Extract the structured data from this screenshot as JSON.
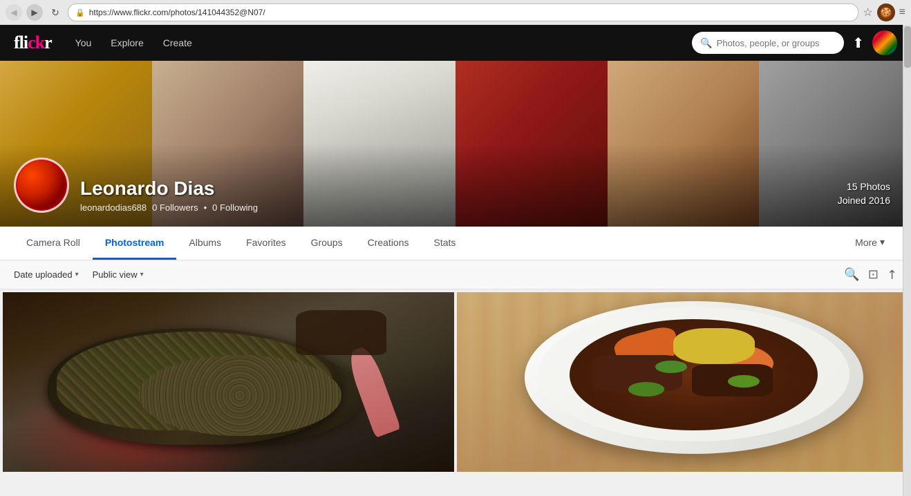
{
  "browser": {
    "url": "https://www.flickr.com/photos/141044352@N07/",
    "back_label": "◀",
    "forward_label": "▶",
    "refresh_label": "↻",
    "star_label": "☆",
    "menu_label": "≡"
  },
  "nav": {
    "logo": "flickr",
    "logo_accent": "fl",
    "you_label": "You",
    "explore_label": "Explore",
    "create_label": "Create",
    "search_placeholder": "Photos, people, or groups",
    "upload_label": "⬆"
  },
  "profile": {
    "name": "Leonardo Dias",
    "username": "leonardodias688",
    "followers": "0 Followers",
    "following": "0 Following",
    "photos_count": "15 Photos",
    "joined": "Joined 2016"
  },
  "tabs": [
    {
      "label": "Camera Roll",
      "active": false
    },
    {
      "label": "Photostream",
      "active": true
    },
    {
      "label": "Albums",
      "active": false
    },
    {
      "label": "Favorites",
      "active": false
    },
    {
      "label": "Groups",
      "active": false
    },
    {
      "label": "Creations",
      "active": false
    },
    {
      "label": "Stats",
      "active": false
    }
  ],
  "more_tab": "More",
  "filters": {
    "date_label": "Date uploaded",
    "view_label": "Public view"
  },
  "filter_actions": {
    "search_icon": "🔍",
    "slideshow_icon": "⊡",
    "share_icon": "↗"
  }
}
